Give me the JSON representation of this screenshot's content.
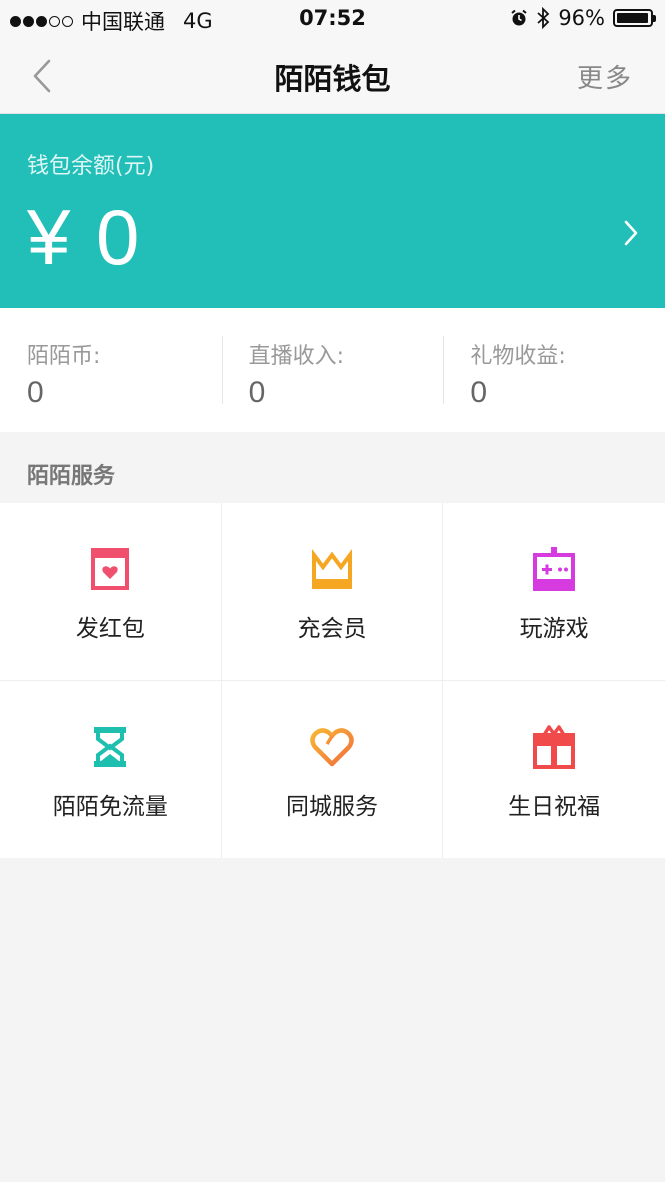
{
  "status_bar": {
    "carrier": "中国联通",
    "network": "4G",
    "time": "07:52",
    "battery_percent": "96%",
    "battery_level": 0.96
  },
  "nav": {
    "title": "陌陌钱包",
    "more": "更多"
  },
  "balance": {
    "label": "钱包余额(元)",
    "amount": "¥ 0"
  },
  "stats": [
    {
      "label": "陌陌币:",
      "value": "0"
    },
    {
      "label": "直播收入:",
      "value": "0"
    },
    {
      "label": "礼物收益:",
      "value": "0"
    }
  ],
  "section": {
    "title": "陌陌服务"
  },
  "services": [
    {
      "label": "发红包",
      "icon": "red-envelope-icon",
      "color": "#f0506e"
    },
    {
      "label": "充会员",
      "icon": "crown-icon",
      "color": "#f5a623"
    },
    {
      "label": "玩游戏",
      "icon": "game-controller-icon",
      "color": "#d63be0"
    },
    {
      "label": "陌陌免流量",
      "icon": "hourglass-icon",
      "color": "#1fbfb0"
    },
    {
      "label": "同城服务",
      "icon": "heart-icon",
      "color": "#f5a623"
    },
    {
      "label": "生日祝福",
      "icon": "gift-icon",
      "color": "#f04a4a"
    }
  ],
  "colors": {
    "accent": "#22bfb8",
    "background": "#f4f4f4"
  }
}
